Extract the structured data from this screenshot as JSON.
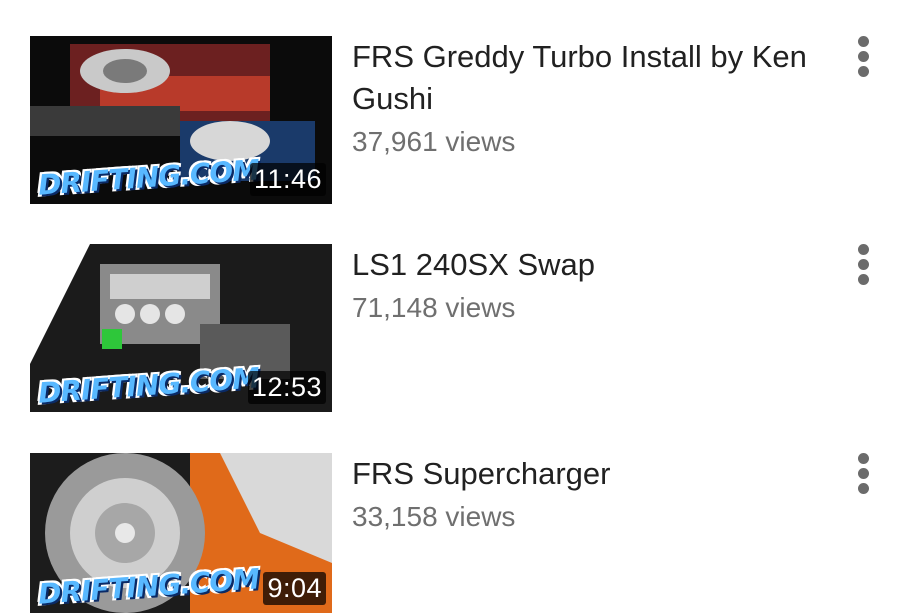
{
  "videos": [
    {
      "title": "FRS Greddy Turbo Install by Ken Gushi",
      "views": "37,961 views",
      "duration": "11:46",
      "thumbnail_brand": "DRIFTING.COM"
    },
    {
      "title": "LS1 240SX Swap",
      "views": "71,148 views",
      "duration": "12:53",
      "thumbnail_brand": "DRIFTING.COM"
    },
    {
      "title": "FRS Supercharger",
      "views": "33,158 views",
      "duration": "9:04",
      "thumbnail_brand": "DRIFTING.COM"
    }
  ],
  "icons": {
    "menu": "more-vert-icon"
  },
  "colors": {
    "title": "#212121",
    "views": "#6f6f6f",
    "menu_dots": "#6b6b6b"
  }
}
